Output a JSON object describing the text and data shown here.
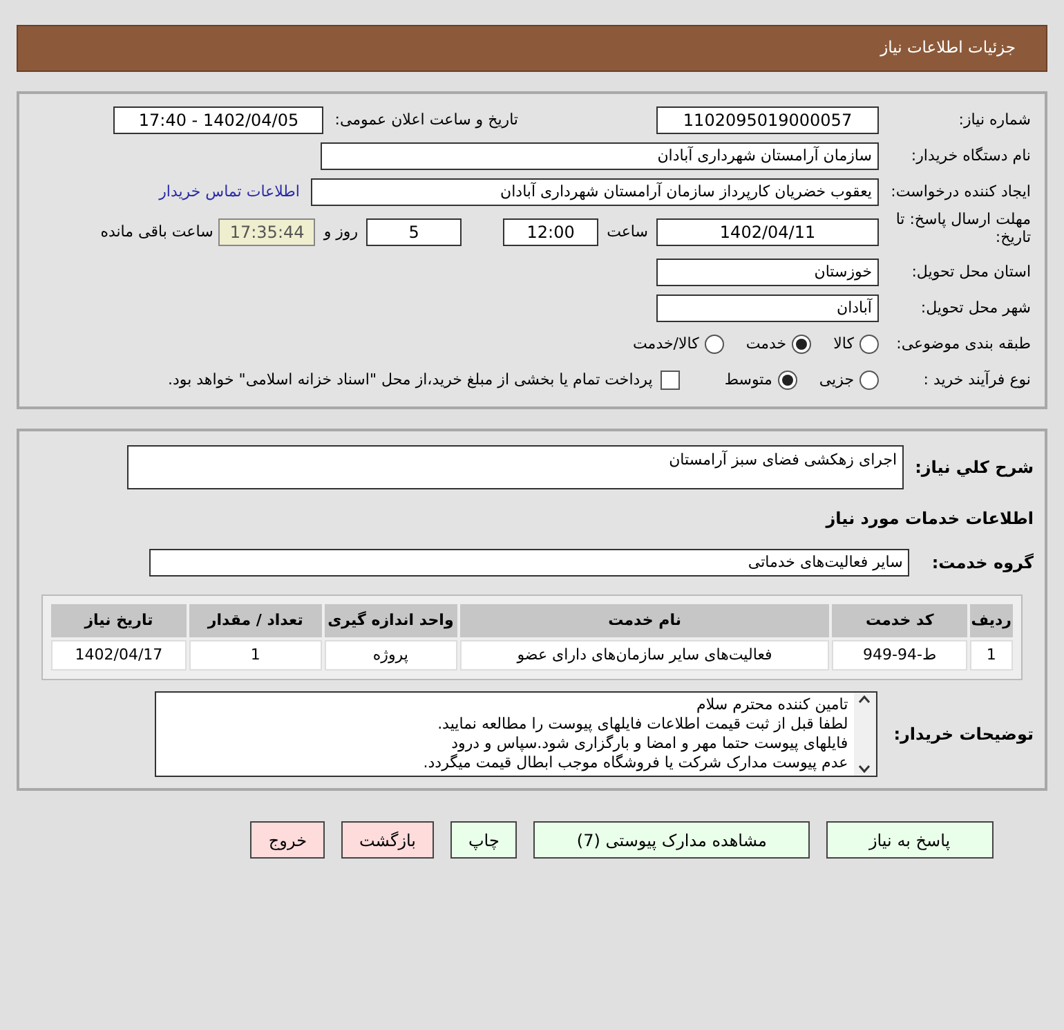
{
  "header": {
    "title": "جزئیات اطلاعات نیاز"
  },
  "need_number": {
    "label": "شماره نیاز:",
    "value": "1102095019000057"
  },
  "announce": {
    "label": "تاریخ و ساعت اعلان عمومی:",
    "value": "1402/04/05 - 17:40"
  },
  "buyer_org": {
    "label": "نام دستگاه خریدار:",
    "value": "سازمان آرامستان شهرداری آبادان"
  },
  "requester": {
    "label": "ایجاد کننده درخواست:",
    "value": "یعقوب خضریان کارپرداز سازمان آرامستان شهرداری آبادان",
    "link": "اطلاعات تماس خریدار"
  },
  "deadline": {
    "label": "مهلت ارسال پاسخ: تا تاریخ:",
    "date": "1402/04/11",
    "time_label": "ساعت",
    "time": "12:00",
    "days": "5",
    "days_label": "روز و",
    "remaining": "17:35:44",
    "remaining_label": "ساعت باقی مانده"
  },
  "province": {
    "label": "استان محل تحویل:",
    "value": "خوزستان"
  },
  "city": {
    "label": "شهر محل تحویل:",
    "value": "آبادان"
  },
  "category": {
    "label": "طبقه بندی موضوعی:",
    "options": [
      {
        "label": "کالا",
        "selected": false
      },
      {
        "label": "خدمت",
        "selected": true
      },
      {
        "label": "کالا/خدمت",
        "selected": false
      }
    ]
  },
  "process": {
    "label": "نوع فرآیند خرید :",
    "options": [
      {
        "label": "جزیی",
        "selected": false
      },
      {
        "label": "متوسط",
        "selected": true
      }
    ],
    "checkbox": {
      "label": "پرداخت تمام یا بخشی از مبلغ خرید،از محل \"اسناد خزانه اسلامی\" خواهد بود.",
      "checked": false
    }
  },
  "description": {
    "label": "شرح کلي نیاز:",
    "value": "اجرای زهکشی فضای سبز آرامستان"
  },
  "services_title": "اطلاعات خدمات مورد نیاز",
  "service_group": {
    "label": "گروه خدمت:",
    "value": "سایر فعالیت‌های خدماتی"
  },
  "table": {
    "columns": [
      "ردیف",
      "کد خدمت",
      "نام خدمت",
      "واحد اندازه گیری",
      "تعداد / مقدار",
      "تاریخ نیاز"
    ],
    "rows": [
      [
        "1",
        "ط-94-949",
        "فعالیت‌های سایر سازمان‌های دارای عضو",
        "پروژه",
        "1",
        "1402/04/17"
      ]
    ]
  },
  "buyer_notes": {
    "label": "توضیحات خریدار:",
    "lines": [
      "تامین کننده محترم سلام",
      "لطفا قبل از ثبت قیمت اطلاعات فایلهای پیوست را مطالعه نمایید.",
      "فایلهای پیوست حتما مهر و امضا و بارگزاری شود.سپاس و درود",
      "عدم پیوست مدارک شرکت یا فروشگاه موجب ابطال قیمت میگردد."
    ]
  },
  "buttons": [
    {
      "label": "پاسخ به نیاز",
      "kind": "green"
    },
    {
      "label": "مشاهده مدارک پیوستی (7)",
      "kind": "green"
    },
    {
      "label": "چاپ",
      "kind": "green"
    },
    {
      "label": "بازگشت",
      "kind": "pink"
    },
    {
      "label": "خروج",
      "kind": "pink"
    }
  ]
}
